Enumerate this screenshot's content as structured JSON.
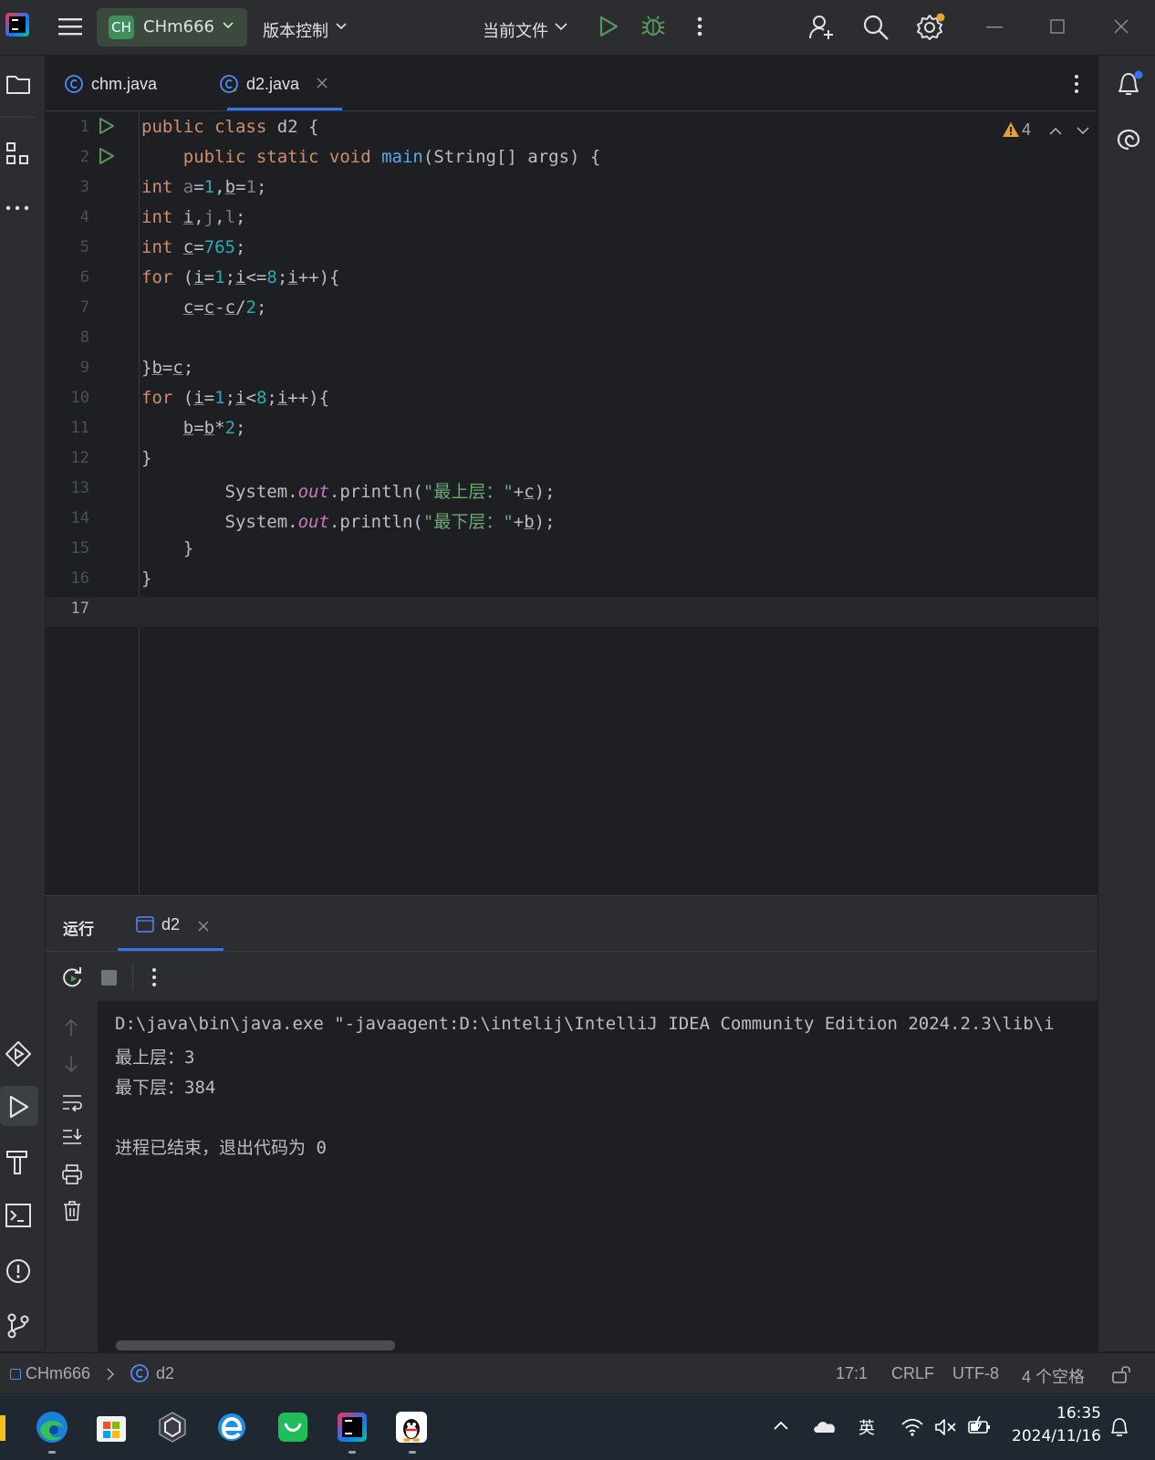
{
  "titlebar": {
    "project_badge": "CH",
    "project_name": "CHm666",
    "vcs_menu": "版本控制",
    "run_config": "当前文件"
  },
  "tabs": [
    {
      "label": "chm.java"
    },
    {
      "label": "d2.java"
    }
  ],
  "editor": {
    "warning_count": "4",
    "line_numbers": [
      "1",
      "2",
      "3",
      "4",
      "5",
      "6",
      "7",
      "8",
      "9",
      "10",
      "11",
      "12",
      "13",
      "14",
      "15",
      "16",
      "17"
    ]
  },
  "run_panel": {
    "title": "运行",
    "tab_label": "d2",
    "console": [
      "D:\\java\\bin\\java.exe \"-javaagent:D:\\intelij\\IntelliJ IDEA Community Edition 2024.2.3\\lib\\i",
      "最上层：3",
      "最下层：384",
      "",
      "进程已结束，退出代码为 0"
    ]
  },
  "statusbar": {
    "project": "CHm666",
    "file": "d2",
    "position": "17:1",
    "line_sep": "CRLF",
    "encoding": "UTF-8",
    "indent": "4 个空格"
  },
  "taskbar": {
    "ime": "英",
    "time": "16:35",
    "date": "2024/11/16"
  },
  "colors": {
    "background": "#1e1f22",
    "panel": "#2b2d30",
    "keyword": "#cf8e6d",
    "number": "#2aacb8",
    "function": "#56a8f5",
    "string": "#6aab73",
    "run_green": "#57965c"
  }
}
